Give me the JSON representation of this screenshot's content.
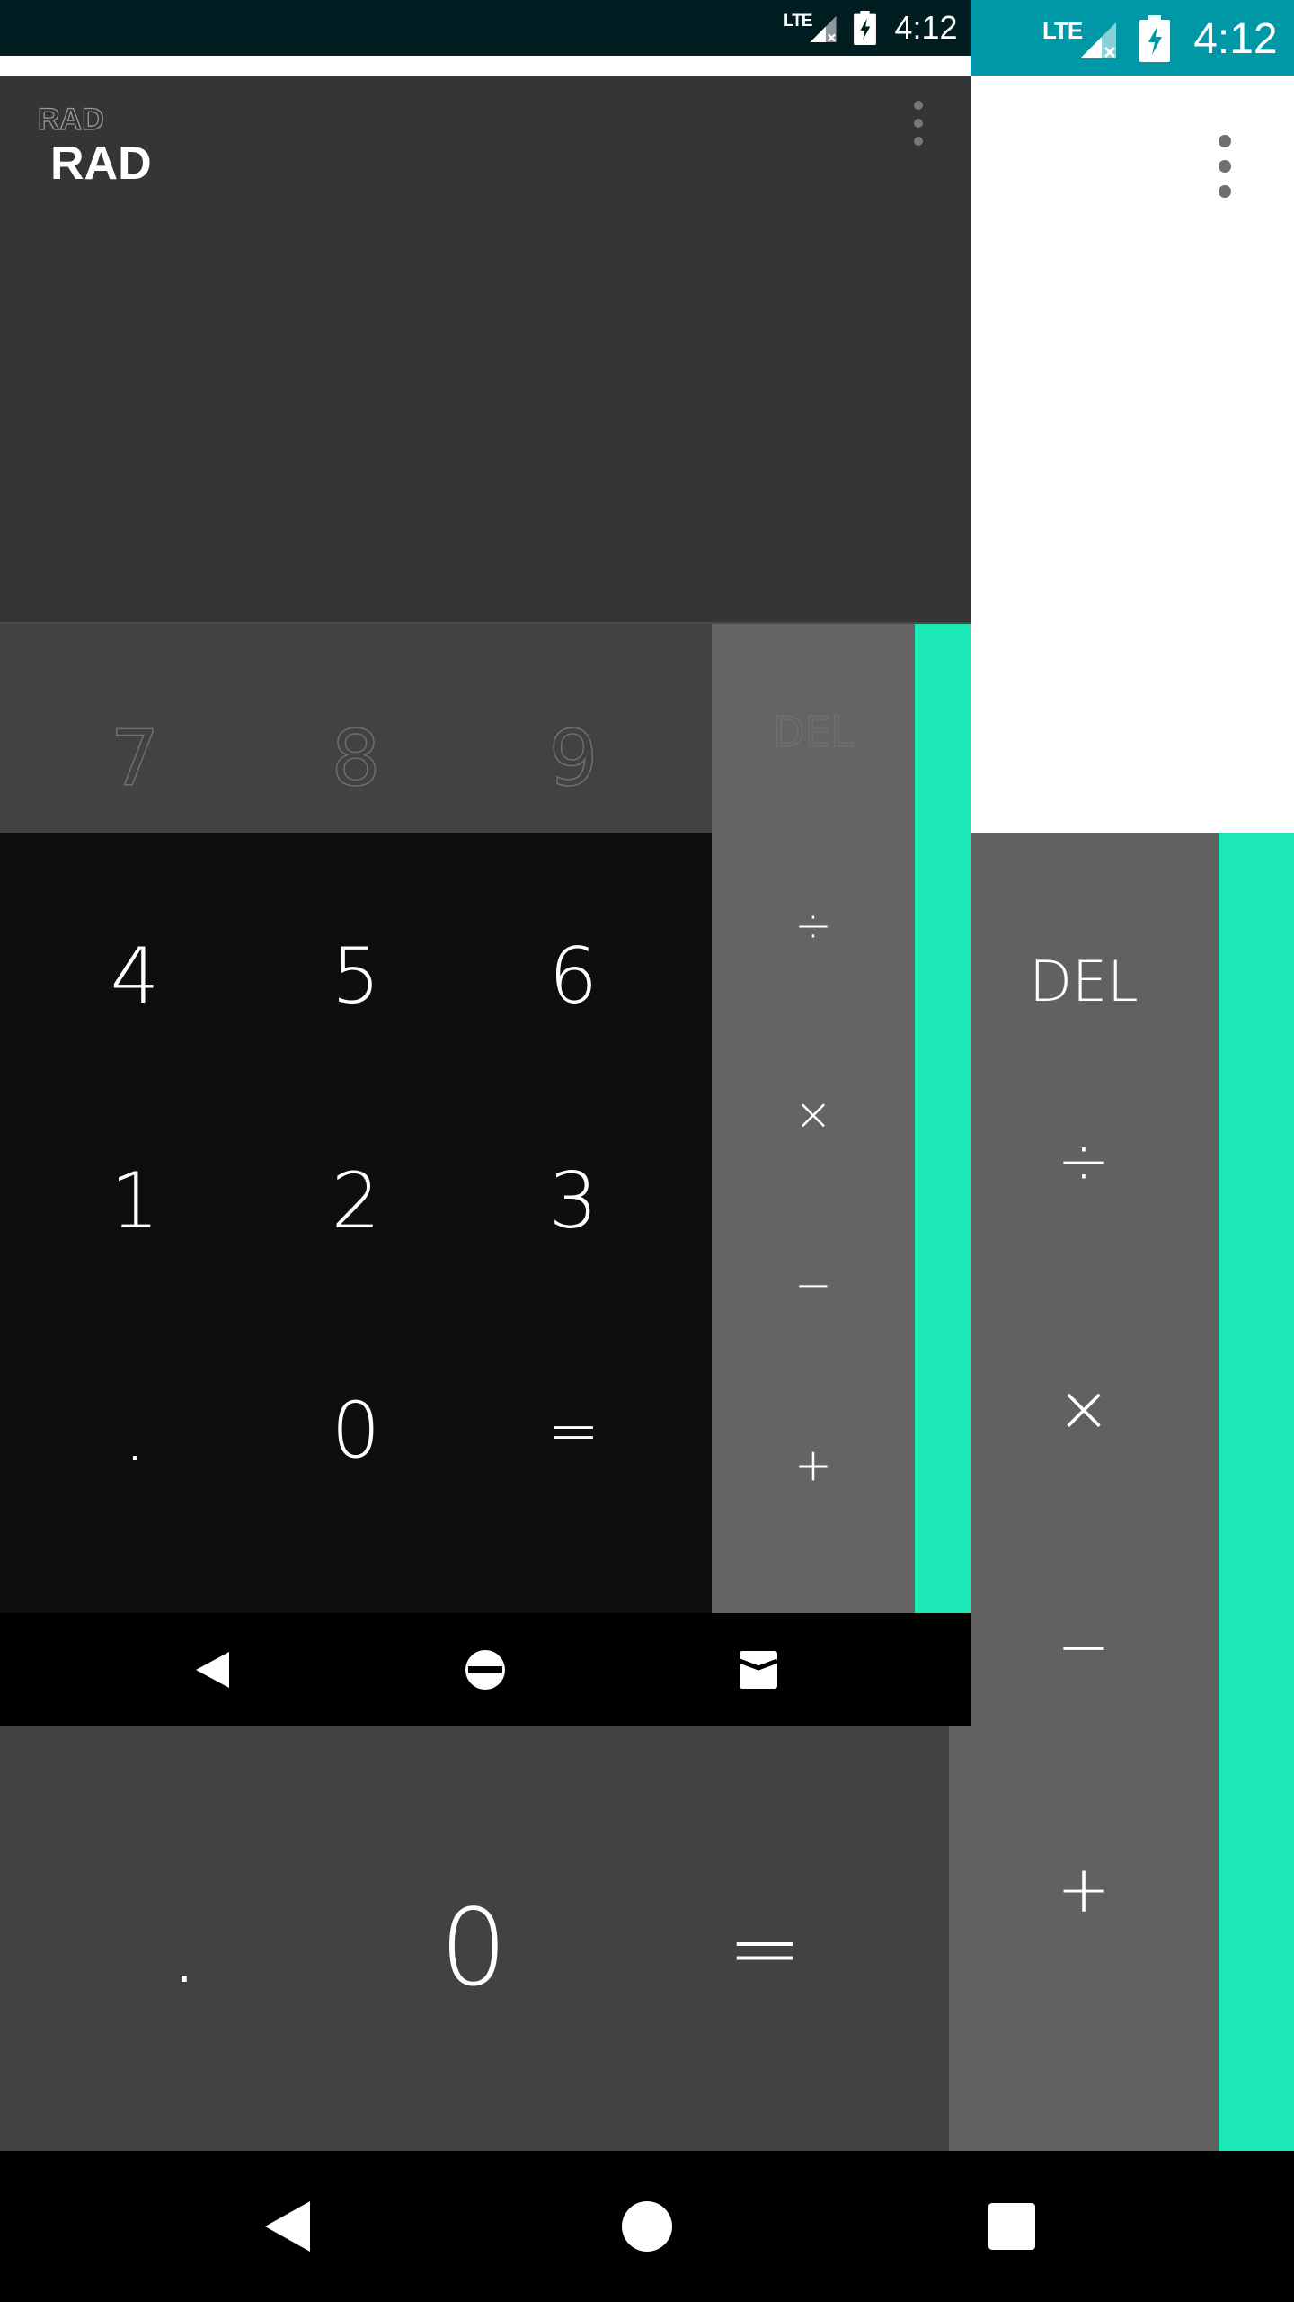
{
  "status_bar": {
    "network": "LTE",
    "time": "4:12"
  },
  "calculator": {
    "mode_indicator": "RAD",
    "keys": {
      "row1": [
        "7",
        "8",
        "9"
      ],
      "row2": [
        "4",
        "5",
        "6"
      ],
      "row3": [
        "1",
        "2",
        "3"
      ],
      "row4": [
        ".",
        "0",
        "="
      ]
    },
    "operators": [
      "DEL",
      "÷",
      "×",
      "−",
      "+"
    ]
  },
  "colors": {
    "status_bar_back": "#0097a7",
    "status_bar_front": "#001d22",
    "display_back": "#ffffff",
    "display_front": "#353535",
    "pad_numeric": "#424242",
    "pad_numeric_front": "#0e0e0e",
    "pad_operators": "#616161",
    "accent": "#1de9b6"
  },
  "icons": {
    "overflow": "more-vert-icon",
    "signal": "signal-no-data-icon",
    "battery": "battery-charging-icon",
    "nav_back": "back-triangle-icon",
    "nav_home": "home-circle-icon",
    "nav_recents": "recents-square-icon"
  }
}
